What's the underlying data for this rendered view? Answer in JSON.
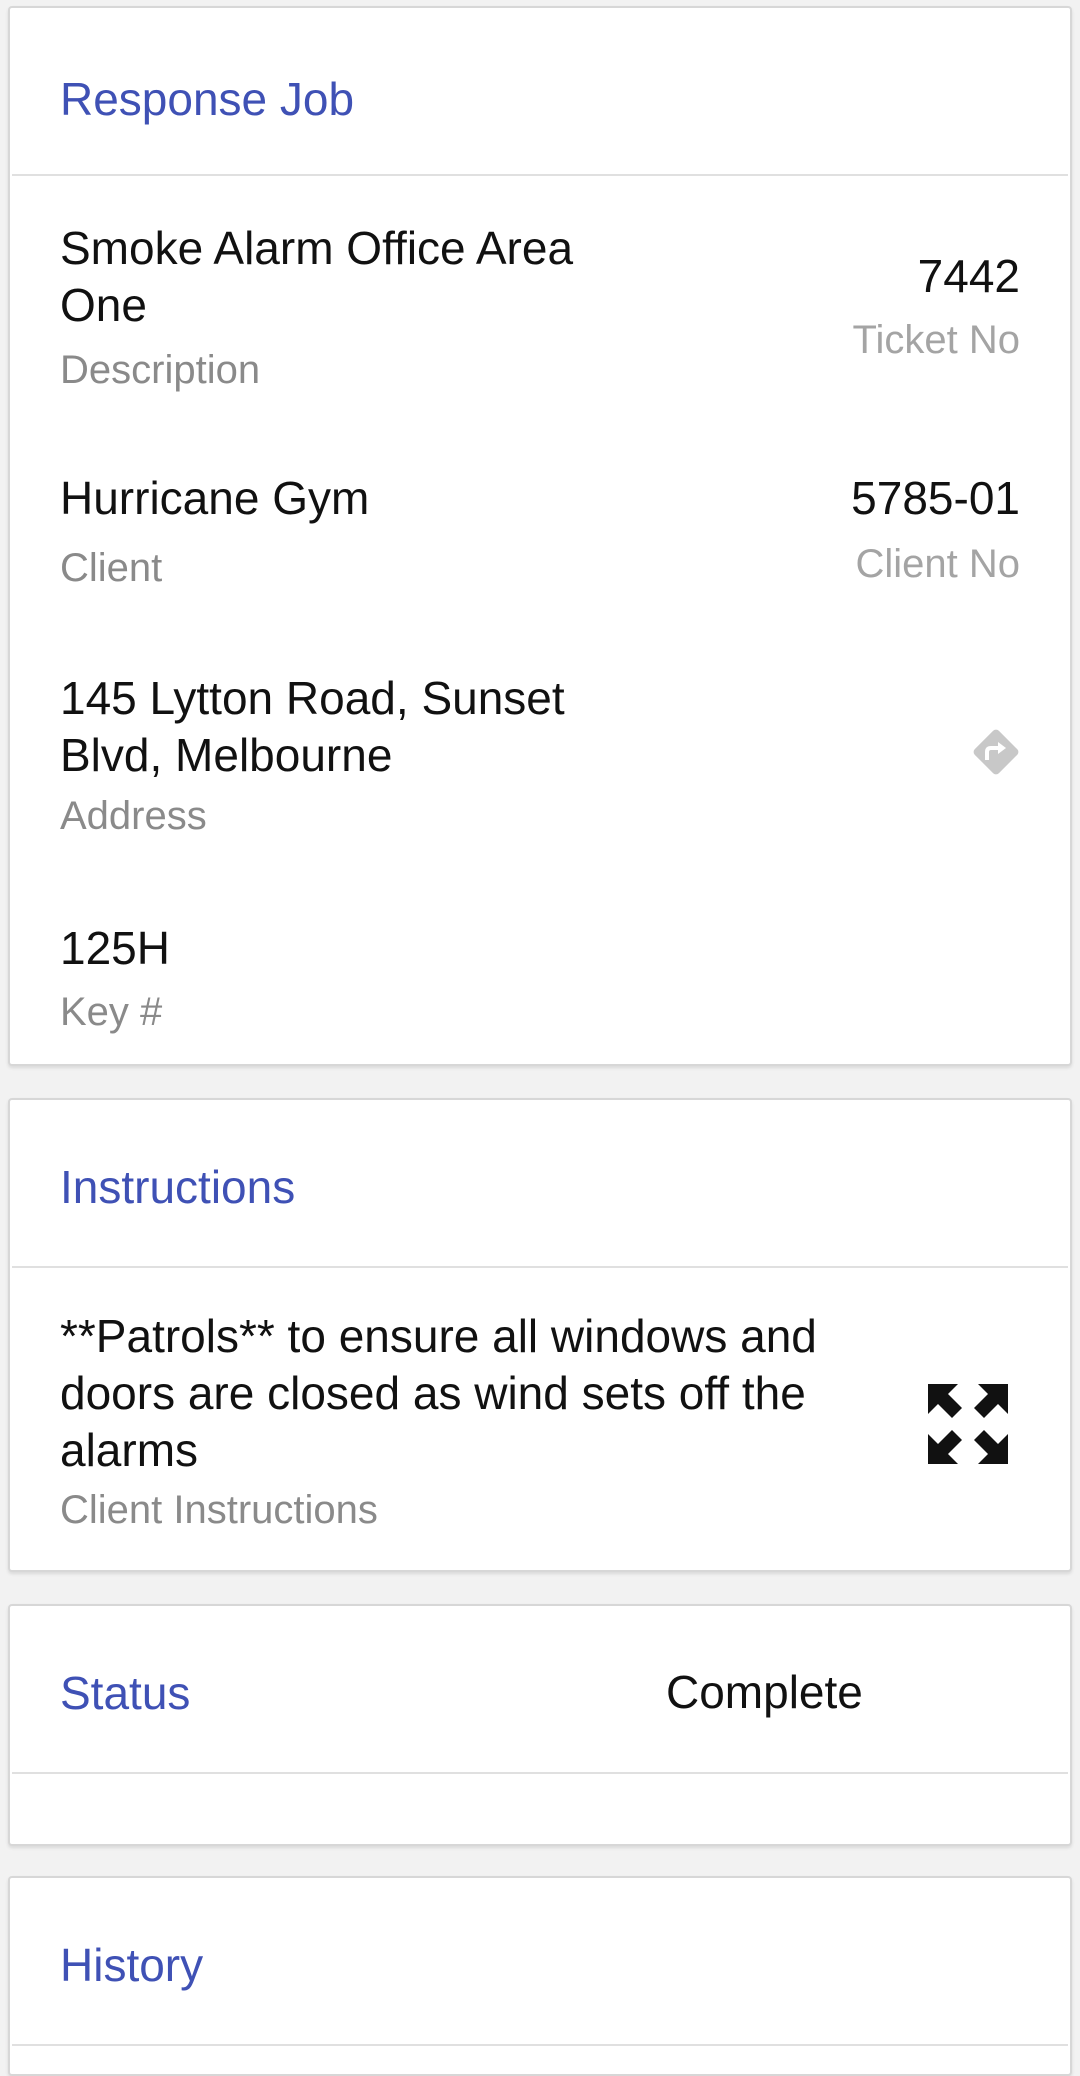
{
  "response_job": {
    "title": "Response Job",
    "description": {
      "value": "Smoke Alarm Office Area One",
      "label": "Description"
    },
    "ticket": {
      "value": "7442",
      "label": "Ticket No"
    },
    "client": {
      "value": "Hurricane Gym",
      "label": "Client"
    },
    "client_no": {
      "value": "5785-01",
      "label": "Client No"
    },
    "address": {
      "value": "145 Lytton Road, Sunset Blvd, Melbourne",
      "label": "Address",
      "icon": "directions-icon"
    },
    "key": {
      "value": "125H",
      "label": "Key #"
    }
  },
  "instructions": {
    "title": "Instructions",
    "client_instructions": {
      "value": "**Patrols** to ensure all windows and doors are closed as wind sets off the alarms",
      "label": "Client Instructions"
    },
    "expand_icon": "expand-icon"
  },
  "status": {
    "title": "Status",
    "value": "Complete"
  },
  "history": {
    "title": "History"
  },
  "colors": {
    "accent": "#3f51b5",
    "primary_text": "#111111",
    "secondary_text": "#8a8a8a",
    "icon_gray": "#c8c8c8"
  }
}
